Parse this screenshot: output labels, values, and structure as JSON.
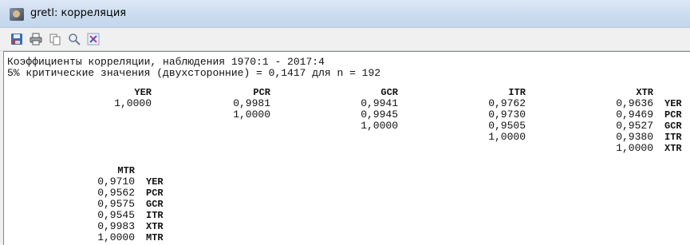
{
  "window": {
    "title": "gretl: корреляция",
    "icon": "gretl-app-icon"
  },
  "toolbar": {
    "buttons": [
      {
        "name": "save-icon"
      },
      {
        "name": "print-icon"
      },
      {
        "name": "copy-icon"
      },
      {
        "name": "find-icon"
      },
      {
        "name": "close-icon"
      }
    ]
  },
  "output": {
    "line1": "Коэффициенты корреляции, наблюдения 1970:1 - 2017:4",
    "line2": "5% критические значения (двухсторонние) = 0,1417 для n = 192",
    "block1": {
      "headers": [
        "YER",
        "PCR",
        "GCR",
        "ITR",
        "XTR"
      ],
      "rows": [
        {
          "cells": [
            "1,0000",
            "0,9981",
            "0,9941",
            "0,9762",
            "0,9636"
          ],
          "label": "YER"
        },
        {
          "cells": [
            "",
            "1,0000",
            "0,9945",
            "0,9730",
            "0,9469"
          ],
          "label": "PCR"
        },
        {
          "cells": [
            "",
            "",
            "1,0000",
            "0,9505",
            "0,9527"
          ],
          "label": "GCR"
        },
        {
          "cells": [
            "",
            "",
            "",
            "1,0000",
            "0,9380"
          ],
          "label": "ITR"
        },
        {
          "cells": [
            "",
            "",
            "",
            "",
            "1,0000"
          ],
          "label": "XTR"
        }
      ]
    },
    "block2": {
      "header": "MTR",
      "rows": [
        {
          "value": "0,9710",
          "label": "YER"
        },
        {
          "value": "0,9562",
          "label": "PCR"
        },
        {
          "value": "0,9575",
          "label": "GCR"
        },
        {
          "value": "0,9545",
          "label": "ITR"
        },
        {
          "value": "0,9983",
          "label": "XTR"
        },
        {
          "value": "1,0000",
          "label": "MTR"
        }
      ]
    }
  }
}
